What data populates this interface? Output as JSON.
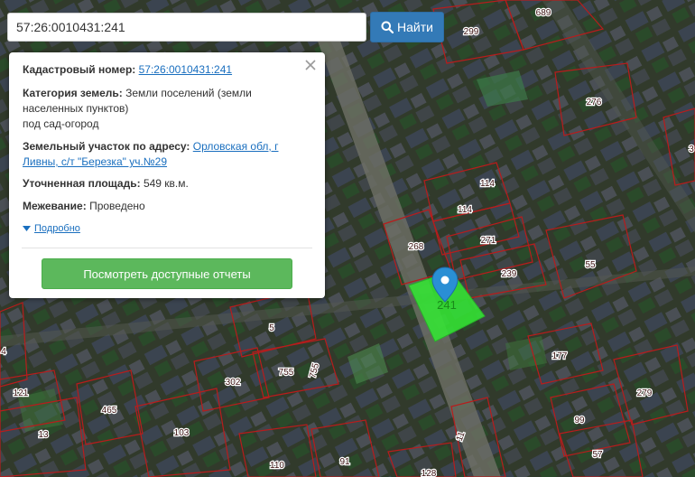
{
  "search": {
    "query": "57:26:0010431:241",
    "button_label": "Найти"
  },
  "info": {
    "cadastral_label": "Кадастровый номер:",
    "cadastral_value": "57:26:0010431:241",
    "category_label": "Категория земель:",
    "category_value_1": "Земли поселений (земли",
    "category_value_2": "населенных пунктов)",
    "category_value_3": "под сад-огород",
    "address_label": "Земельный участок по адресу:",
    "address_value_1": "Орловская обл, г",
    "address_value_2": "Ливны, с/т \"Березка\" уч.№29",
    "area_label": "Уточненная площадь:",
    "area_value": "549 кв.м.",
    "survey_label": "Межевание:",
    "survey_value": "Проведено",
    "details_label": "Подробно",
    "reports_button": "Посмотреть доступные отчеты"
  },
  "map": {
    "selected_parcel_label": "241",
    "parcel_labels": [
      "689",
      "299",
      "276",
      "114",
      "114",
      "268",
      "271",
      "239",
      "55",
      "5",
      "755",
      "755",
      "302",
      "4",
      "121",
      "465",
      "13",
      "103",
      "110",
      "91",
      "128",
      "11",
      "177",
      "279",
      "99",
      "57",
      "3"
    ],
    "colors": {
      "parcel_border": "#b81c1c",
      "selected_fill": "#33e633",
      "marker": "#2a8fd4",
      "accent_blue": "#337ab7",
      "accent_green": "#5cb85c"
    }
  }
}
